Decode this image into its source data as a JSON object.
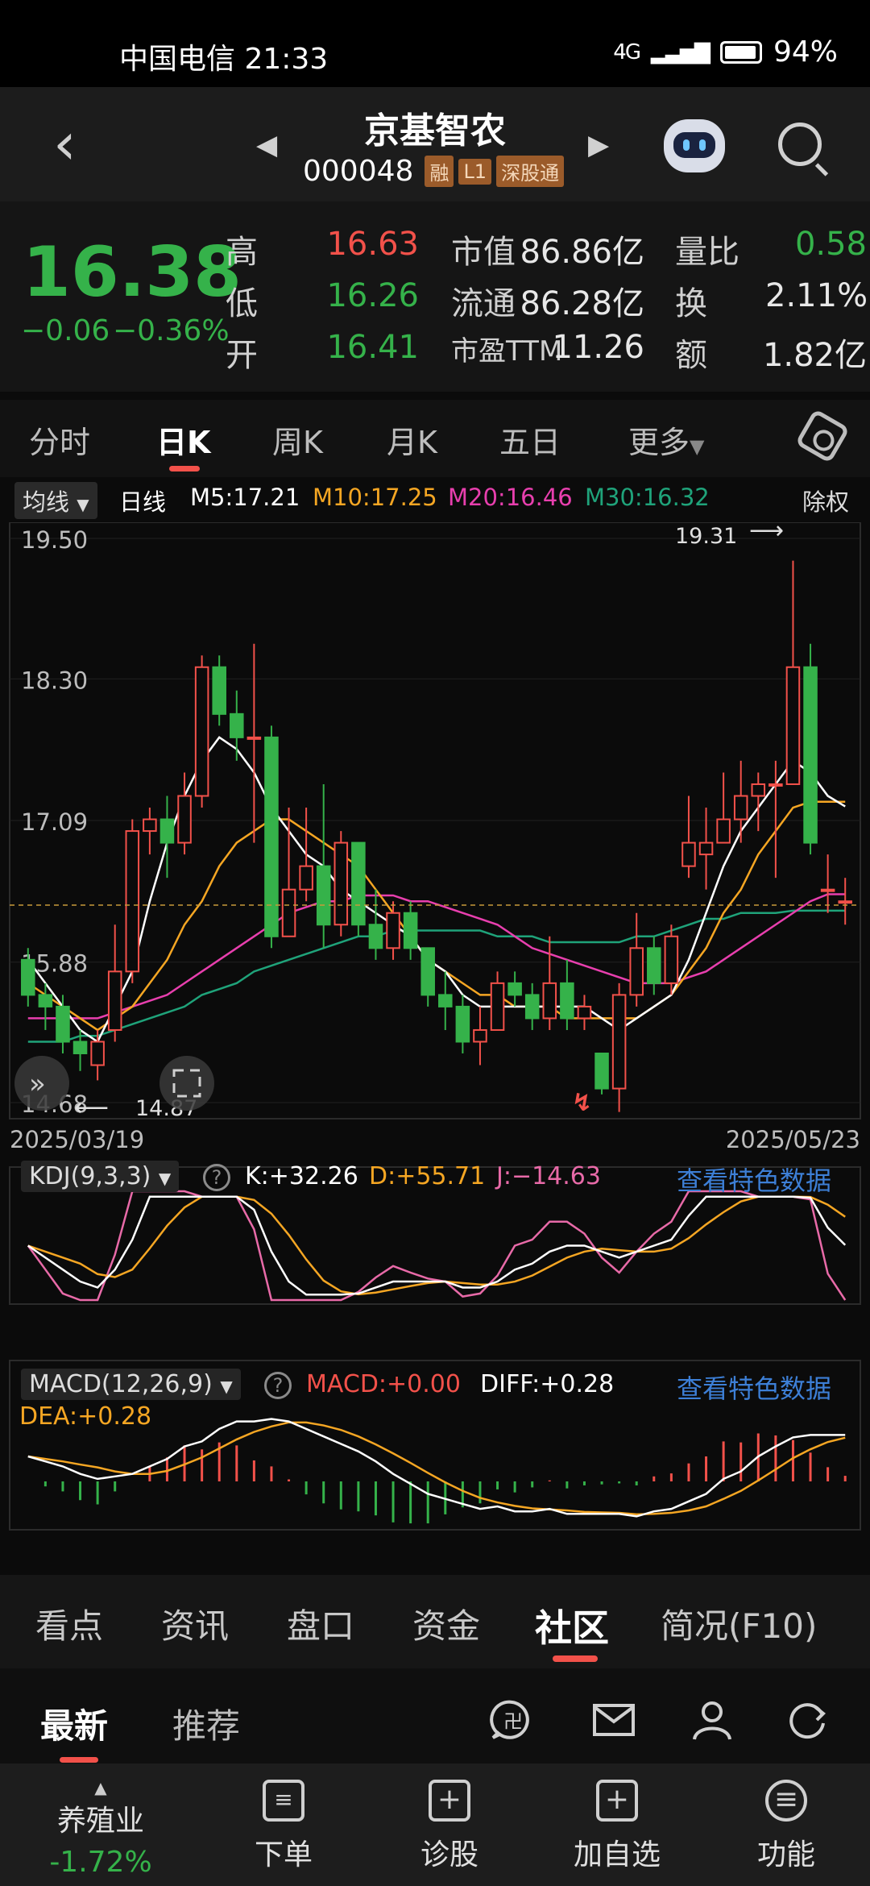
{
  "status_bar": {
    "carrier_time": "中国电信 21:33",
    "network": "4G",
    "battery": "94%"
  },
  "header": {
    "title": "京基智农",
    "code": "000048",
    "tags": [
      "融",
      "L1",
      "深股通"
    ]
  },
  "quote": {
    "price": "16.38",
    "change": "−0.06",
    "change_pct": "−0.36%",
    "rows": [
      {
        "l1": "高",
        "v1": "16.63",
        "l2": "市值",
        "v2": "86.86亿",
        "l3": "量比",
        "v3": "0.58"
      },
      {
        "l1": "低",
        "v1": "16.26",
        "l2": "流通",
        "v2": "86.28亿",
        "l3": "换",
        "v3": "2.11%"
      },
      {
        "l1": "开",
        "v1": "16.41",
        "l2": "市盈TTM",
        "v2": "11.26",
        "l3": "额",
        "v3": "1.82亿"
      }
    ]
  },
  "period_tabs": [
    "分时",
    "日K",
    "周K",
    "月K",
    "五日",
    "更多"
  ],
  "ma_bar": {
    "selector": "均线",
    "period": "日线",
    "m5": "M5:17.21",
    "m10": "M10:17.25",
    "m20": "M20:16.46",
    "m30": "M30:16.32",
    "adjust": "除权"
  },
  "colors": {
    "up": "#f2514a",
    "down": "#35b24a",
    "m5": "#ffffff",
    "m10": "#f5a623",
    "m20": "#e83fae",
    "m30": "#1fa37a",
    "link": "#3d7fd6"
  },
  "chart_data": [
    {
      "type": "candlestick",
      "y_ticks": [
        "19.50",
        "18.30",
        "17.09",
        "15.88",
        "14.68"
      ],
      "ylim": [
        14.68,
        19.5
      ],
      "x_start": "2025/03/19",
      "x_end": "2025/05/23",
      "high_label": "19.31",
      "low_label": "14.87",
      "candles": [
        [
          15.9,
          15.6,
          16.0,
          15.5
        ],
        [
          15.6,
          15.5,
          15.7,
          15.3
        ],
        [
          15.5,
          15.2,
          15.6,
          15.1
        ],
        [
          15.2,
          15.1,
          15.3,
          14.95
        ],
        [
          15.0,
          15.2,
          15.3,
          14.87
        ],
        [
          15.3,
          15.8,
          16.2,
          15.2
        ],
        [
          15.8,
          17.0,
          17.1,
          15.7
        ],
        [
          17.0,
          17.1,
          17.2,
          16.8
        ],
        [
          17.1,
          16.9,
          17.3,
          16.6
        ],
        [
          16.9,
          17.3,
          17.5,
          16.8
        ],
        [
          17.3,
          18.4,
          18.5,
          17.2
        ],
        [
          18.4,
          18.0,
          18.5,
          17.9
        ],
        [
          18.0,
          17.8,
          18.2,
          17.6
        ],
        [
          17.8,
          17.8,
          18.6,
          16.9
        ],
        [
          17.8,
          16.1,
          17.9,
          16.0
        ],
        [
          16.1,
          16.5,
          17.2,
          16.1
        ],
        [
          16.5,
          16.7,
          17.2,
          16.4
        ],
        [
          16.7,
          16.2,
          17.4,
          16.0
        ],
        [
          16.2,
          16.9,
          17.0,
          16.1
        ],
        [
          16.9,
          16.2,
          16.9,
          16.1
        ],
        [
          16.2,
          16.0,
          16.5,
          15.9
        ],
        [
          16.0,
          16.3,
          16.4,
          15.9
        ],
        [
          16.3,
          16.0,
          16.4,
          15.9
        ],
        [
          16.0,
          15.6,
          16.0,
          15.5
        ],
        [
          15.6,
          15.5,
          15.8,
          15.3
        ],
        [
          15.5,
          15.2,
          15.6,
          15.1
        ],
        [
          15.2,
          15.3,
          15.5,
          15.0
        ],
        [
          15.3,
          15.7,
          15.8,
          15.3
        ],
        [
          15.7,
          15.6,
          15.8,
          15.5
        ],
        [
          15.6,
          15.4,
          15.7,
          15.3
        ],
        [
          15.4,
          15.7,
          16.1,
          15.3
        ],
        [
          15.7,
          15.4,
          15.9,
          15.3
        ],
        [
          15.4,
          15.5,
          15.6,
          15.3
        ],
        [
          15.1,
          14.8,
          15.1,
          14.75
        ],
        [
          14.8,
          15.6,
          15.7,
          14.6
        ],
        [
          15.6,
          16.0,
          16.3,
          15.5
        ],
        [
          16.0,
          15.7,
          16.1,
          15.6
        ],
        [
          15.7,
          16.1,
          16.2,
          15.6
        ],
        [
          16.7,
          16.9,
          17.3,
          16.6
        ],
        [
          16.8,
          16.9,
          17.2,
          16.5
        ],
        [
          16.9,
          17.1,
          17.5,
          16.9
        ],
        [
          17.1,
          17.3,
          17.6,
          16.9
        ],
        [
          17.3,
          17.4,
          17.5,
          17.0
        ],
        [
          17.4,
          17.4,
          17.6,
          16.6
        ],
        [
          17.4,
          18.4,
          19.31,
          17.4
        ],
        [
          18.4,
          16.9,
          18.6,
          16.8
        ],
        [
          16.5,
          16.5,
          16.8,
          16.3
        ],
        [
          16.4,
          16.4,
          16.6,
          16.2
        ]
      ],
      "ma5": [
        15.9,
        15.7,
        15.5,
        15.3,
        15.2,
        15.5,
        15.8,
        16.4,
        16.9,
        17.3,
        17.6,
        17.8,
        17.7,
        17.5,
        17.2,
        17.0,
        16.8,
        16.7,
        16.5,
        16.4,
        16.3,
        16.2,
        16.1,
        15.9,
        15.8,
        15.6,
        15.5,
        15.5,
        15.5,
        15.5,
        15.5,
        15.5,
        15.5,
        15.4,
        15.3,
        15.4,
        15.5,
        15.6,
        15.9,
        16.3,
        16.7,
        17.0,
        17.2,
        17.4,
        17.6,
        17.5,
        17.3,
        17.21
      ],
      "ma10": [
        15.7,
        15.6,
        15.5,
        15.4,
        15.3,
        15.4,
        15.5,
        15.7,
        15.9,
        16.2,
        16.4,
        16.7,
        16.9,
        17.0,
        17.1,
        17.1,
        17.0,
        16.9,
        16.8,
        16.7,
        16.5,
        16.3,
        16.1,
        15.9,
        15.8,
        15.7,
        15.6,
        15.6,
        15.5,
        15.5,
        15.5,
        15.4,
        15.4,
        15.4,
        15.4,
        15.4,
        15.5,
        15.6,
        15.8,
        16.0,
        16.3,
        16.5,
        16.8,
        17.0,
        17.2,
        17.25,
        17.25,
        17.25
      ],
      "ma20": [
        15.4,
        15.4,
        15.4,
        15.4,
        15.4,
        15.45,
        15.5,
        15.55,
        15.6,
        15.7,
        15.8,
        15.9,
        16.0,
        16.1,
        16.2,
        16.3,
        16.35,
        16.4,
        16.4,
        16.45,
        16.45,
        16.45,
        16.4,
        16.4,
        16.35,
        16.3,
        16.25,
        16.2,
        16.1,
        16.0,
        15.95,
        15.9,
        15.85,
        15.8,
        15.75,
        15.7,
        15.7,
        15.7,
        15.75,
        15.8,
        15.9,
        16.0,
        16.1,
        16.2,
        16.3,
        16.4,
        16.46,
        16.46
      ],
      "ma30": [
        15.2,
        15.2,
        15.2,
        15.25,
        15.25,
        15.3,
        15.35,
        15.4,
        15.45,
        15.5,
        15.6,
        15.65,
        15.7,
        15.8,
        15.85,
        15.9,
        15.95,
        16.0,
        16.05,
        16.1,
        16.1,
        16.15,
        16.15,
        16.15,
        16.15,
        16.15,
        16.15,
        16.1,
        16.1,
        16.1,
        16.05,
        16.05,
        16.05,
        16.05,
        16.05,
        16.1,
        16.1,
        16.15,
        16.2,
        16.25,
        16.25,
        16.3,
        16.3,
        16.3,
        16.32,
        16.32,
        16.32,
        16.32
      ]
    },
    {
      "type": "line",
      "name": "KDJ(9,3,3)",
      "K": "K:+32.26",
      "D": "D:+55.71",
      "J": "J:−14.63",
      "ylim": [
        0,
        100
      ]
    },
    {
      "type": "bar",
      "name": "MACD(12,26,9)",
      "MACD": "MACD:+0.00",
      "DIFF": "DIFF:+0.28",
      "DEA": "DEA:+0.28"
    }
  ],
  "kdj": {
    "selector": "KDJ(9,3,3)",
    "k": "K:+32.26",
    "d": "D:+55.71",
    "j": "J:−14.63",
    "see": "查看特色数据"
  },
  "macd": {
    "selector": "MACD(12,26,9)",
    "macd": "MACD:+0.00",
    "diff": "DIFF:+0.28",
    "dea": "DEA:+0.28",
    "see": "查看特色数据"
  },
  "info_tabs": [
    "看点",
    "资讯",
    "盘口",
    "资金",
    "社区",
    "简况(F10)"
  ],
  "sub_tabs": [
    "最新",
    "推荐"
  ],
  "bottom_bar": {
    "sector": "养殖业",
    "sector_change": "-1.72%",
    "items": [
      "下单",
      "诊股",
      "加自选",
      "功能"
    ]
  }
}
